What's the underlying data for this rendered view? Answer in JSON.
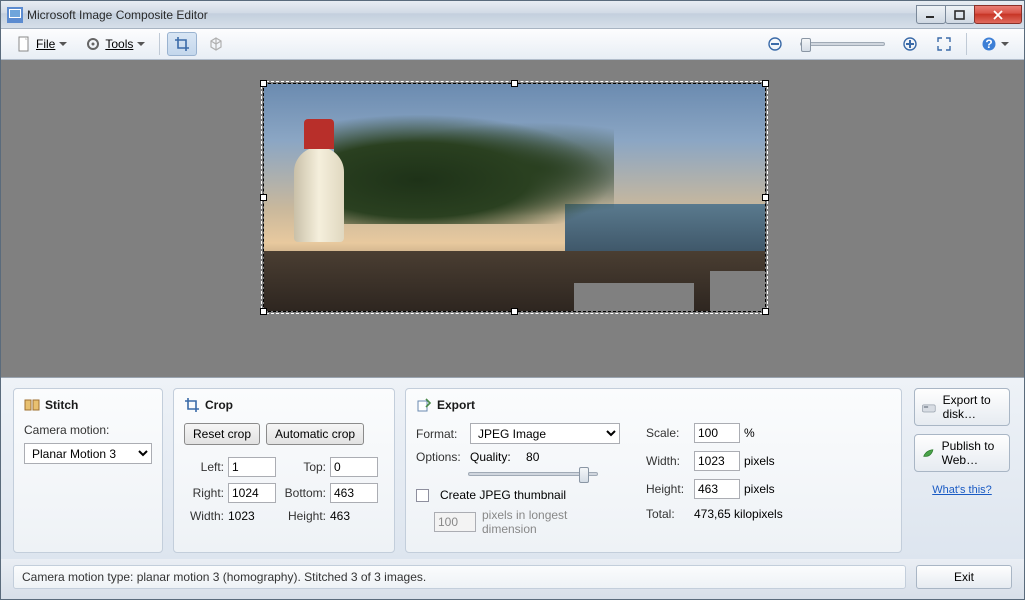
{
  "window": {
    "title": "Microsoft Image Composite Editor"
  },
  "toolbar": {
    "file": "File",
    "tools": "Tools"
  },
  "stitch": {
    "heading": "Stitch",
    "motion_label": "Camera motion:",
    "motion_value": "Planar Motion 3"
  },
  "crop": {
    "heading": "Crop",
    "reset": "Reset crop",
    "auto": "Automatic crop",
    "left_label": "Left:",
    "left": "1",
    "top_label": "Top:",
    "top": "0",
    "right_label": "Right:",
    "right": "1024",
    "bottom_label": "Bottom:",
    "bottom": "463",
    "width_label": "Width:",
    "width": "1023",
    "height_label": "Height:",
    "height": "463"
  },
  "export": {
    "heading": "Export",
    "format_label": "Format:",
    "format": "JPEG Image",
    "options_label": "Options:",
    "quality_label": "Quality:",
    "quality": "80",
    "thumb_label": "Create JPEG thumbnail",
    "thumb_px": "100",
    "thumb_hint": "pixels in longest dimension",
    "scale_label": "Scale:",
    "scale": "100",
    "scale_unit": "%",
    "width_label": "Width:",
    "width": "1023",
    "px": "pixels",
    "height_label": "Height:",
    "height": "463",
    "total_label": "Total:",
    "total": "473,65 kilopixels"
  },
  "side": {
    "export_disk": "Export to disk…",
    "publish": "Publish to Web…",
    "whats_this": "What's this?"
  },
  "status": {
    "text": "Camera motion type: planar motion 3 (homography). Stitched 3 of 3 images."
  },
  "exit": "Exit"
}
